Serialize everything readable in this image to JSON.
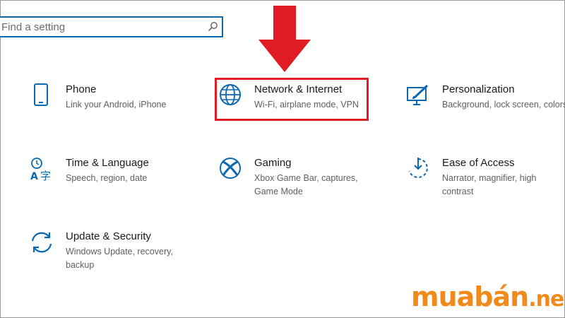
{
  "search": {
    "placeholder": "Find a setting"
  },
  "tiles": [
    {
      "title": "Phone",
      "desc": "Link your Android, iPhone",
      "icon": "phone-icon"
    },
    {
      "title": "Network & Internet",
      "desc": "Wi-Fi, airplane mode, VPN",
      "icon": "globe-icon"
    },
    {
      "title": "Personalization",
      "desc": "Background, lock screen, colors",
      "icon": "personalization-icon"
    },
    {
      "title": "Time & Language",
      "desc": "Speech, region, date",
      "icon": "time-language-icon"
    },
    {
      "title": "Gaming",
      "desc": "Xbox Game Bar, captures, Game Mode",
      "icon": "xbox-icon"
    },
    {
      "title": "Ease of Access",
      "desc": "Narrator, magnifier, high contrast",
      "icon": "ease-of-access-icon"
    },
    {
      "title": "Update & Security",
      "desc": "Windows Update, recovery, backup",
      "icon": "update-icon"
    }
  ],
  "annotation": {
    "highlighted_tile": "Network & Internet",
    "color": "#e01b24"
  },
  "watermark": {
    "brand": "muabán",
    "suffix": ".net"
  },
  "colors": {
    "accent": "#0a67b1",
    "annotation": "#e01b24",
    "watermark": "#f28a1b"
  }
}
